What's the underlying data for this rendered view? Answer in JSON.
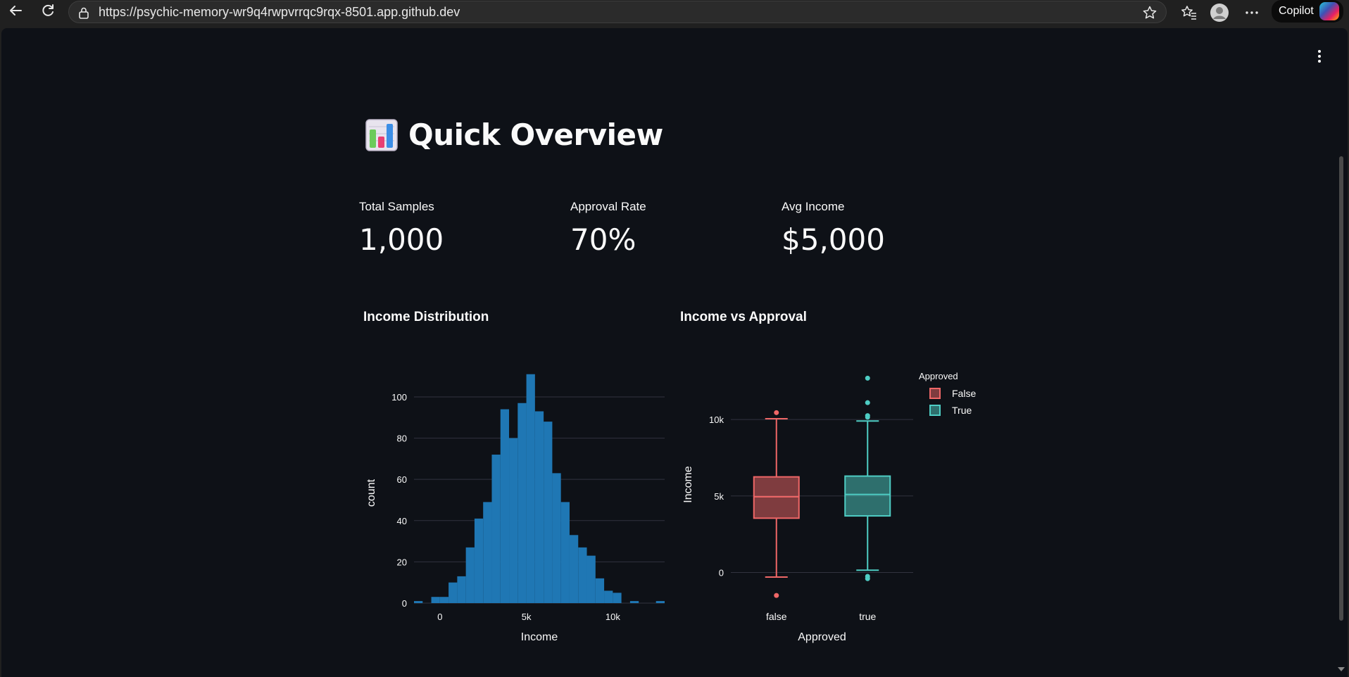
{
  "browser": {
    "url": "https://psychic-memory-wr9q4rwpvrrqc9rqx-8501.app.github.dev",
    "copilot_label": "Copilot"
  },
  "page": {
    "title": "Quick Overview",
    "title_icon": "bar-chart-emoji-icon"
  },
  "metrics": [
    {
      "label": "Total Samples",
      "value": "1,000"
    },
    {
      "label": "Approval Rate",
      "value": "70%"
    },
    {
      "label": "Avg Income",
      "value": "$5,000"
    }
  ],
  "sections": {
    "hist_title": "Income Distribution",
    "box_title": "Income vs Approval"
  },
  "colors": {
    "app_bg": "#0e1117",
    "hist_bar": "#1f77b4",
    "false_box": "#ef6767",
    "true_box": "#4ecdc4"
  },
  "chart_data": [
    {
      "type": "bar",
      "subtype": "histogram",
      "xlabel": "Income",
      "ylabel": "count",
      "x_tick_labels": [
        "0",
        "5k",
        "10k"
      ],
      "y_tick_labels": [
        "0",
        "20",
        "40",
        "60",
        "80",
        "100"
      ],
      "ylim": [
        0,
        115
      ],
      "xlim": [
        -1500,
        13000
      ],
      "bin_width": 500,
      "bins": [
        {
          "x0": -1500,
          "count": 1
        },
        {
          "x0": -500,
          "count": 3
        },
        {
          "x0": 0,
          "count": 3
        },
        {
          "x0": 500,
          "count": 10
        },
        {
          "x0": 1000,
          "count": 13
        },
        {
          "x0": 1500,
          "count": 27
        },
        {
          "x0": 2000,
          "count": 41
        },
        {
          "x0": 2500,
          "count": 49
        },
        {
          "x0": 3000,
          "count": 72
        },
        {
          "x0": 3500,
          "count": 94
        },
        {
          "x0": 4000,
          "count": 80
        },
        {
          "x0": 4500,
          "count": 97
        },
        {
          "x0": 5000,
          "count": 111
        },
        {
          "x0": 5500,
          "count": 93
        },
        {
          "x0": 6000,
          "count": 88
        },
        {
          "x0": 6500,
          "count": 63
        },
        {
          "x0": 7000,
          "count": 49
        },
        {
          "x0": 7500,
          "count": 33
        },
        {
          "x0": 8000,
          "count": 27
        },
        {
          "x0": 8500,
          "count": 23
        },
        {
          "x0": 9000,
          "count": 12
        },
        {
          "x0": 9500,
          "count": 6
        },
        {
          "x0": 10000,
          "count": 5
        },
        {
          "x0": 11000,
          "count": 1
        },
        {
          "x0": 12500,
          "count": 1
        }
      ]
    },
    {
      "type": "box",
      "xlabel": "Approved",
      "ylabel": "Income",
      "categories": [
        "false",
        "true"
      ],
      "y_tick_labels": [
        "0",
        "5k",
        "10k"
      ],
      "ylim": [
        -2000,
        13500
      ],
      "legend": {
        "title": "Approved",
        "position": "top-right",
        "entries": [
          "False",
          "True"
        ]
      },
      "series": [
        {
          "name": "False",
          "category": "false",
          "q1": 3550,
          "median": 4950,
          "q3": 6250,
          "whisker_low": -300,
          "whisker_high": 10050,
          "outliers": [
            10450,
            -1500
          ]
        },
        {
          "name": "True",
          "category": "true",
          "q1": 3700,
          "median": 5100,
          "q3": 6300,
          "whisker_low": 150,
          "whisker_high": 9900,
          "outliers": [
            12700,
            11100,
            10250,
            10150,
            -250,
            -400
          ]
        }
      ]
    }
  ]
}
